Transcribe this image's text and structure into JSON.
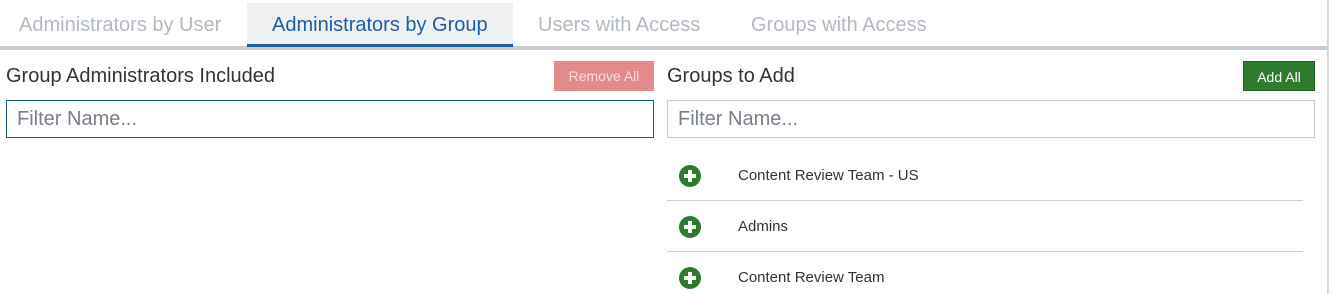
{
  "tabs": [
    {
      "label": "Administrators by User",
      "active": false
    },
    {
      "label": "Administrators by Group",
      "active": true
    },
    {
      "label": "Users with Access",
      "active": false
    },
    {
      "label": "Groups with Access",
      "active": false
    }
  ],
  "left_panel": {
    "title": "Group Administrators Included",
    "remove_all_label": "Remove All",
    "filter_placeholder": "Filter Name...",
    "filter_value": ""
  },
  "right_panel": {
    "title": "Groups to Add",
    "add_all_label": "Add All",
    "filter_placeholder": "Filter Name...",
    "filter_value": "",
    "groups": [
      {
        "name": "Content Review Team - US",
        "icon": "plus-circle-icon"
      },
      {
        "name": "Admins",
        "icon": "plus-circle-icon"
      },
      {
        "name": "Content Review Team",
        "icon": "plus-circle-icon"
      }
    ]
  },
  "colors": {
    "active_tab": "#1a5fa6",
    "inactive_tab": "#b3bac1",
    "add_green": "#2e7a2e",
    "remove_red": "#e38b8b"
  }
}
